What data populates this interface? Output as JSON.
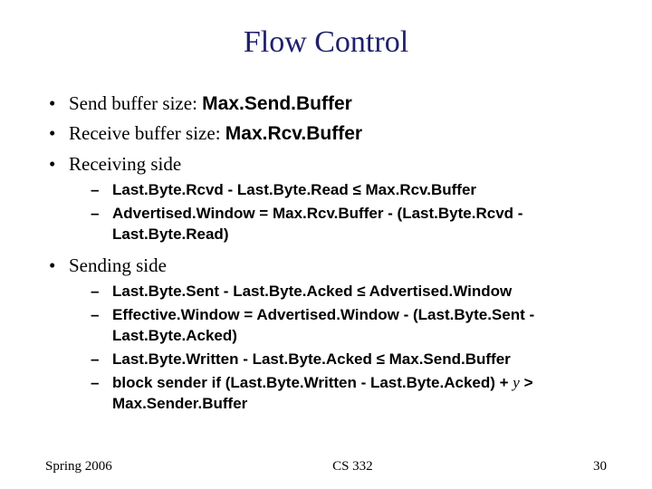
{
  "title": "Flow Control",
  "bullets": {
    "b1_prefix": "Send buffer size: ",
    "b1_code": "Max.Send.Buffer",
    "b2_prefix": "Receive buffer size: ",
    "b2_code": "Max.Rcv.Buffer",
    "b3": "Receiving side",
    "b4": "Sending side"
  },
  "recv": {
    "r1": "Last.Byte.Rcvd - Last.Byte.Read ≤ Max.Rcv.Buffer",
    "r2": "Advertised.Window = Max.Rcv.Buffer - (Last.Byte.Rcvd - Last.Byte.Read)"
  },
  "send": {
    "s1": "Last.Byte.Sent - Last.Byte.Acked ≤ Advertised.Window",
    "s2": "Effective.Window = Advertised.Window - (Last.Byte.Sent - Last.Byte.Acked)",
    "s3": "Last.Byte.Written - Last.Byte.Acked ≤ Max.Send.Buffer",
    "s4_a": "block sender if (",
    "s4_b": "Last.Byte.Written - Last.Byte.Acked",
    "s4_c": ") + ",
    "s4_y": "y",
    "s4_d": " > ",
    "s4_e": "Max.Sender.Buffer"
  },
  "footer": {
    "left": "Spring 2006",
    "center": "CS 332",
    "right": "30"
  }
}
